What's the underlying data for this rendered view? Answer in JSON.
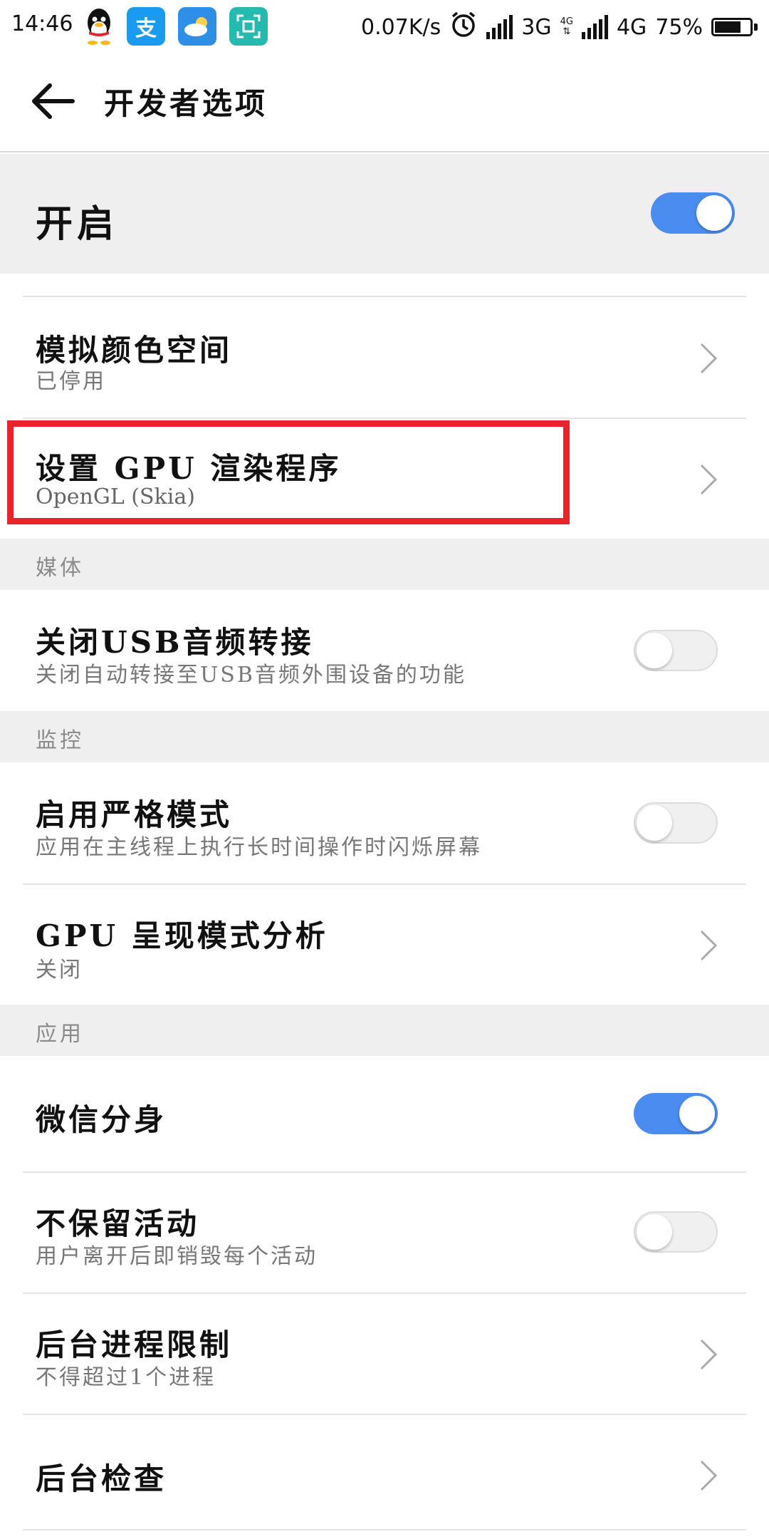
{
  "status_bar": {
    "time": "14:46",
    "net_speed": "0.07K/s",
    "net1": "3G",
    "net2": "4G",
    "net2_mini": "4G",
    "battery": "75%",
    "battery_level": 0.75,
    "apps": [
      "qq-icon",
      "alipay-icon",
      "weather-icon",
      "scanner-icon"
    ]
  },
  "header": {
    "title": "开发者选项"
  },
  "master": {
    "label": "开启",
    "on": true
  },
  "rows": [
    {
      "title": "模拟颜色空间",
      "subtitle": "已停用",
      "control": "chevron"
    },
    {
      "title": "设置 GPU 渲染程序",
      "subtitle": "OpenGL (Skia)",
      "control": "chevron"
    }
  ],
  "sections": {
    "media": "媒体",
    "monitor": "监控",
    "apps": "应用"
  },
  "media_rows": [
    {
      "title": "关闭USB音频转接",
      "subtitle": "关闭自动转接至USB音频外围设备的功能",
      "on": false
    }
  ],
  "monitor_rows": [
    {
      "title": "启用严格模式",
      "subtitle": "应用在主线程上执行长时间操作时闪烁屏幕",
      "on": false
    },
    {
      "title": "GPU 呈现模式分析",
      "subtitle": "关闭",
      "control": "chevron"
    }
  ],
  "app_rows": [
    {
      "title": "微信分身",
      "on": true
    },
    {
      "title": "不保留活动",
      "subtitle": "用户离开后即销毁每个活动",
      "on": false
    },
    {
      "title": "后台进程限制",
      "subtitle": "不得超过1个进程",
      "control": "chevron"
    },
    {
      "title": "后台检查",
      "control": "chevron"
    }
  ],
  "colors": {
    "accent": "#4a8cf0",
    "highlight": "#e8232a"
  }
}
